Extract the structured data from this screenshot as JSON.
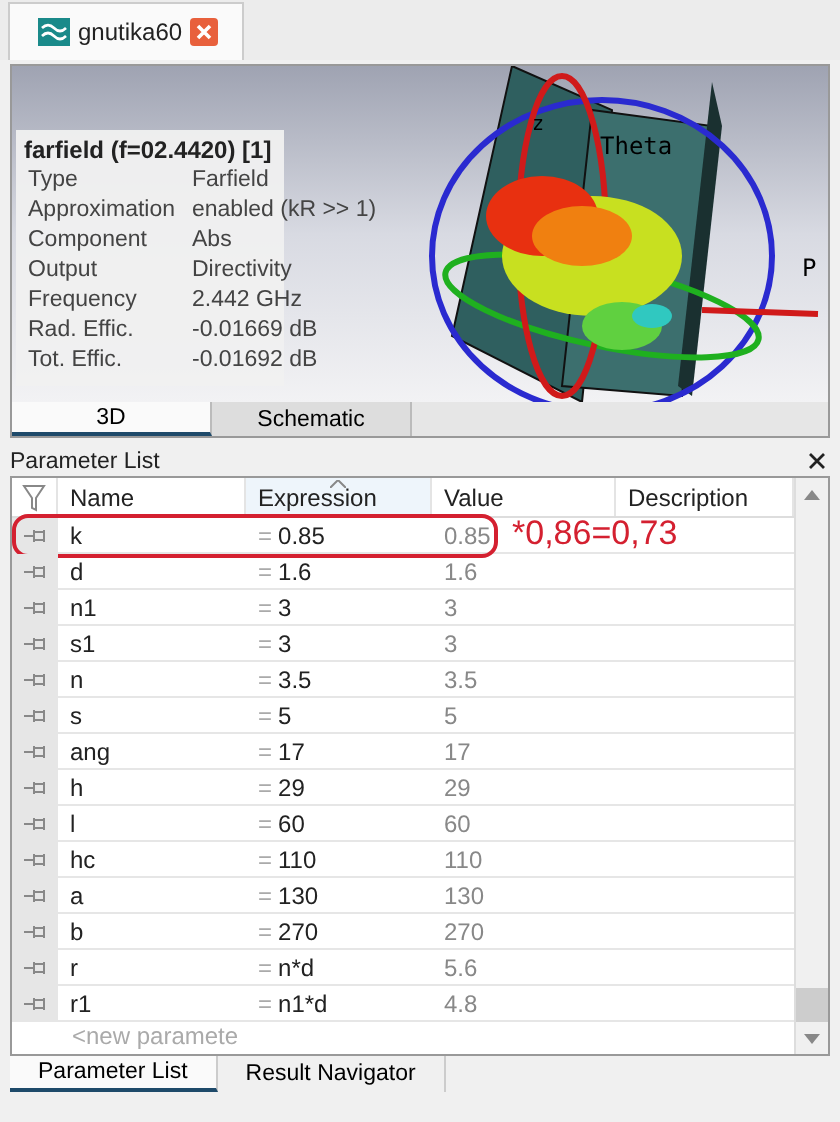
{
  "document_tab": {
    "title": "gnutika60"
  },
  "viewport": {
    "axis_labels": [
      "z",
      "Theta",
      "P"
    ],
    "info": {
      "title": "farfield (f=02.4420) [1]",
      "rows": [
        {
          "label": "Type",
          "value": "Farfield"
        },
        {
          "label": "Approximation",
          "value": "enabled (kR >> 1)"
        },
        {
          "label": "Component",
          "value": "Abs"
        },
        {
          "label": "Output",
          "value": "Directivity"
        },
        {
          "label": "Frequency",
          "value": "2.442 GHz"
        },
        {
          "label": "Rad. Effic.",
          "value": "-0.01669 dB"
        },
        {
          "label": "Tot. Effic.",
          "value": "-0.01692 dB"
        }
      ]
    }
  },
  "view_tabs": [
    {
      "label": "3D",
      "selected": true
    },
    {
      "label": "Schematic",
      "selected": false
    }
  ],
  "parameter_list": {
    "title": "Parameter List",
    "columns": [
      {
        "label": "Name",
        "sorted": false
      },
      {
        "label": "Expression",
        "sorted": true
      },
      {
        "label": "Value",
        "sorted": false
      },
      {
        "label": "Description",
        "sorted": false
      }
    ],
    "rows": [
      {
        "name": "k",
        "operator": "=",
        "expression": "0.85",
        "value": "0.85",
        "circled": true
      },
      {
        "name": "d",
        "operator": "=",
        "expression": "1.6",
        "value": "1.6",
        "circled": false
      },
      {
        "name": "n1",
        "operator": "=",
        "expression": "3",
        "value": "3",
        "circled": false
      },
      {
        "name": "s1",
        "operator": "=",
        "expression": "3",
        "value": "3",
        "circled": false
      },
      {
        "name": "n",
        "operator": "=",
        "expression": "3.5",
        "value": "3.5",
        "circled": false
      },
      {
        "name": "s",
        "operator": "=",
        "expression": "5",
        "value": "5",
        "circled": false
      },
      {
        "name": "ang",
        "operator": "=",
        "expression": "17",
        "value": "17",
        "circled": false
      },
      {
        "name": "h",
        "operator": "=",
        "expression": "29",
        "value": "29",
        "circled": false
      },
      {
        "name": "l",
        "operator": "=",
        "expression": "60",
        "value": "60",
        "circled": false
      },
      {
        "name": "hc",
        "operator": "=",
        "expression": "110",
        "value": "110",
        "circled": false
      },
      {
        "name": "a",
        "operator": "=",
        "expression": "130",
        "value": "130",
        "circled": false
      },
      {
        "name": "b",
        "operator": "=",
        "expression": "270",
        "value": "270",
        "circled": false
      },
      {
        "name": "r",
        "operator": "=",
        "expression": "n*d",
        "value": "5.6",
        "circled": false
      },
      {
        "name": "r1",
        "operator": "=",
        "expression": "n1*d",
        "value": "4.8",
        "circled": false
      }
    ],
    "new_row_placeholder": "<new paramete",
    "annotation": "*0,86=0,73"
  },
  "bottom_tabs": [
    {
      "label": "Parameter List",
      "selected": true
    },
    {
      "label": "Result Navigator",
      "selected": false
    }
  ]
}
